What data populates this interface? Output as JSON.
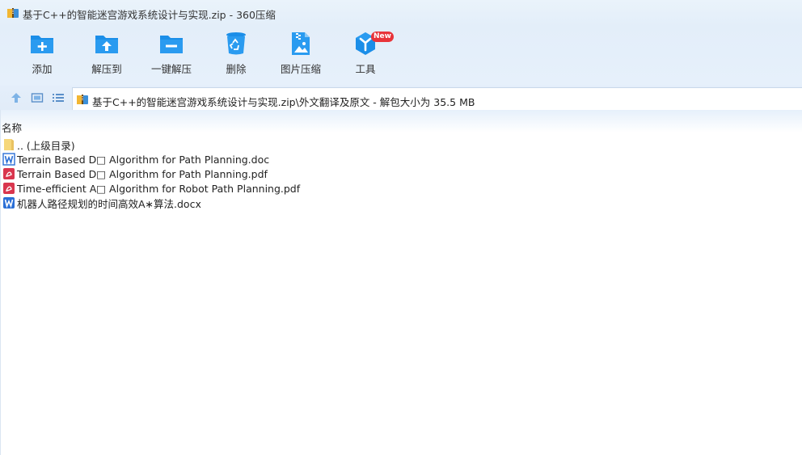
{
  "window": {
    "title": "基于C++的智能迷宫游戏系统设计与实现.zip - 360压缩"
  },
  "toolbar": {
    "items": [
      {
        "label": "添加",
        "icon": "add-folder-icon"
      },
      {
        "label": "解压到",
        "icon": "extract-to-icon"
      },
      {
        "label": "一键解压",
        "icon": "one-click-extract-icon"
      },
      {
        "label": "删除",
        "icon": "recycle-bin-icon"
      },
      {
        "label": "图片压缩",
        "icon": "image-compress-icon"
      },
      {
        "label": "工具",
        "icon": "tools-icon",
        "badge": "New"
      }
    ]
  },
  "address": {
    "path": "基于C++的智能迷宫游戏系统设计与实现.zip\\外文翻译及原文 - 解包大小为 35.5 MB"
  },
  "list": {
    "column_name": "名称",
    "items": [
      {
        "name": ".. (上级目录)",
        "type": "parent-folder"
      },
      {
        "name": "Terrain Based D□ Algorithm for Path Planning.doc",
        "type": "word"
      },
      {
        "name": "Terrain Based D□ Algorithm for Path Planning.pdf",
        "type": "pdf"
      },
      {
        "name": "Time-efficient A□ Algorithm for Robot Path Planning.pdf",
        "type": "pdf"
      },
      {
        "name": "机器人路径规划的时间高效A∗算法.docx",
        "type": "word"
      }
    ]
  },
  "colors": {
    "toolbar_bg": "#e3eef9",
    "icon_blue": "#1b8ee8",
    "badge_red": "#e8343a",
    "pdf_red": "#d9364e",
    "word_blue": "#2b6fd6",
    "folder_yellow": "#f6d77a"
  }
}
